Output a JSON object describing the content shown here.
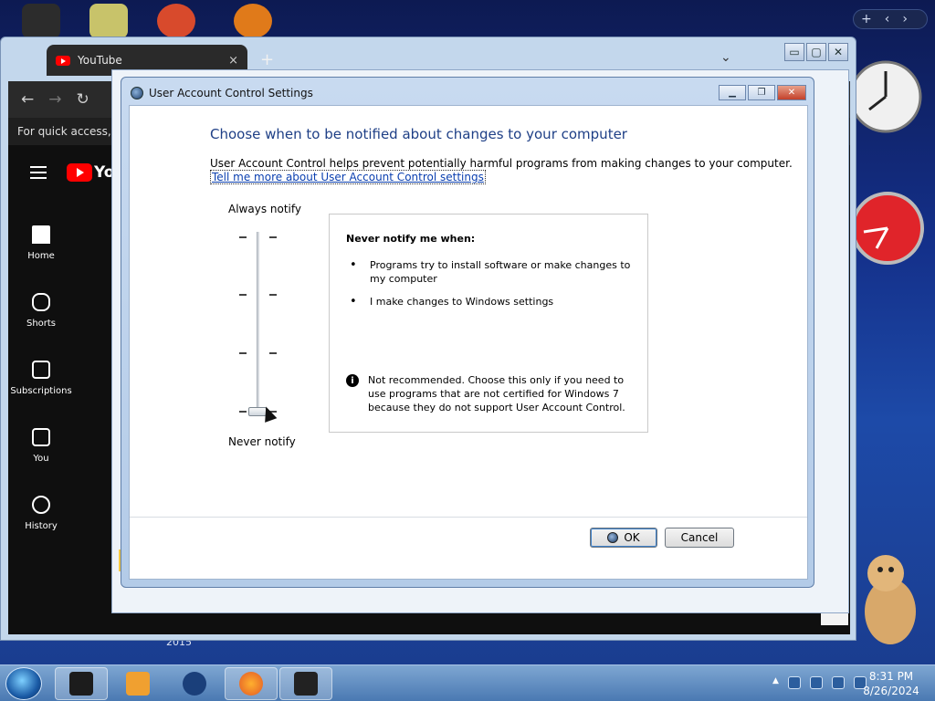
{
  "browser": {
    "tab_title": "YouTube",
    "tab_close": "×",
    "new_tab": "+",
    "quick_access_text": "For quick access, pla",
    "window_controls": [
      "▭",
      "▢",
      "✕"
    ]
  },
  "youtube": {
    "logo_text": "Yo",
    "nav": [
      {
        "label": "Home",
        "icon": "home-icon"
      },
      {
        "label": "Shorts",
        "icon": "shorts-icon"
      },
      {
        "label": "Subscriptions",
        "icon": "subscriptions-icon"
      },
      {
        "label": "You",
        "icon": "you-icon"
      },
      {
        "label": "History",
        "icon": "history-icon"
      }
    ]
  },
  "desktop": {
    "year_label": "2015"
  },
  "uac": {
    "title": "User Account Control Settings",
    "heading": "Choose when to be notified about changes to your computer",
    "description": "User Account Control helps prevent potentially harmful programs from making changes to your computer.",
    "link": "Tell me more about User Account Control settings",
    "slider_top_label": "Always notify",
    "slider_bottom_label": "Never notify",
    "slider_level": 0,
    "slider_levels": 4,
    "info_heading": "Never notify me when:",
    "info_items": [
      "Programs try to install software or make changes to my computer",
      "I make changes to Windows settings"
    ],
    "info_note": "Not recommended. Choose this only if you need to use programs that are not certified for Windows 7 because they do not support User Account Control.",
    "ok_label": "OK",
    "cancel_label": "Cancel"
  },
  "taskbar": {
    "time": "8:31 PM",
    "date": "8/26/2024"
  }
}
